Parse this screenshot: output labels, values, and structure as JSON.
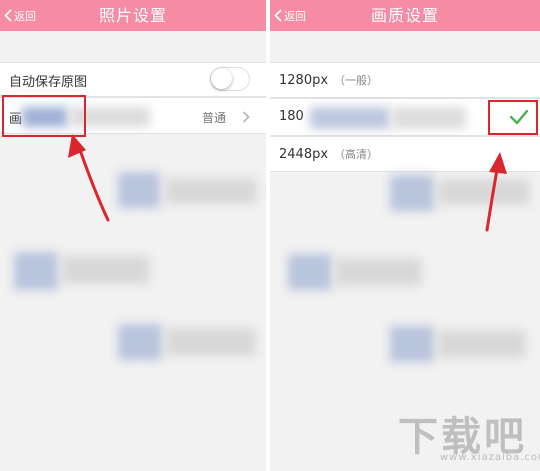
{
  "left": {
    "nav": {
      "back_label": "返回",
      "title": "照片设置"
    },
    "auto_save": {
      "label": "自动保存原图",
      "enabled": false
    },
    "quality_row": {
      "label_visible": "画",
      "value": "普通"
    }
  },
  "right": {
    "nav": {
      "back_label": "返回",
      "title": "画质设置"
    },
    "options": [
      {
        "resolution": "1280px",
        "note": "（一般）",
        "selected": false
      },
      {
        "resolution": "180",
        "note": "",
        "selected": true
      },
      {
        "resolution": "2448px",
        "note": "（高清）",
        "selected": false
      }
    ]
  },
  "colors": {
    "nav_bg": "#f58ca4",
    "highlight_red": "#d9262f",
    "check_green": "#4caf50",
    "page_bg": "#f2f2f2"
  },
  "icons": [
    "chevron-left-icon",
    "chevron-right-icon",
    "toggle-switch",
    "checkmark-icon"
  ],
  "watermark": {
    "text": "下载吧",
    "url": "www.xiazaiba.com"
  }
}
